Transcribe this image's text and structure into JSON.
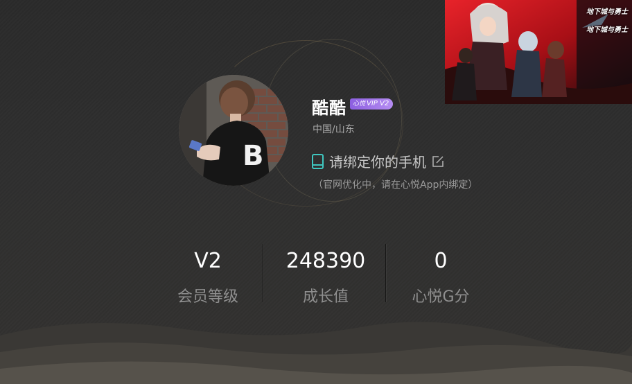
{
  "profile": {
    "username": "酷酷",
    "vip_badge": "VIP V2",
    "vip_badge_mark": "心悦",
    "location": "中国/山东",
    "bind_phone_text": "请绑定你的手机",
    "bind_note": "（官网优化中，请在心悦App内绑定）"
  },
  "stats": [
    {
      "value": "V2",
      "label": "会员等级"
    },
    {
      "value": "248390",
      "label": "成长值"
    },
    {
      "value": "0",
      "label": "心悦G分"
    }
  ],
  "banner": {
    "logo_top": "地下城与勇士",
    "logo_bottom": "地下城与勇士"
  },
  "colors": {
    "background": "#2e2e2e",
    "accent_phone": "#3fc7c0",
    "vip_badge": "#a277ec",
    "banner_red": "#c8141e"
  },
  "icons": {
    "phone": "phone-icon",
    "edit": "edit-icon"
  }
}
